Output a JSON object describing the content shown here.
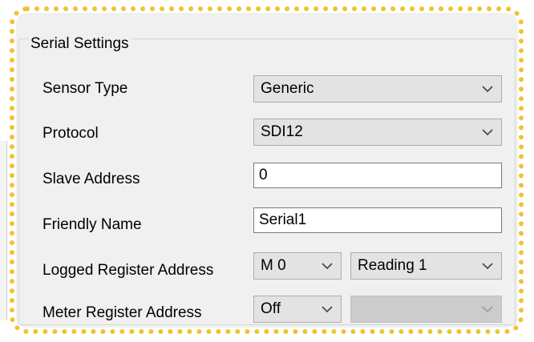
{
  "group": {
    "title": "Serial Settings"
  },
  "rows": {
    "sensor_type": {
      "label": "Sensor Type",
      "value": "Generic"
    },
    "protocol": {
      "label": "Protocol",
      "value": "SDI12"
    },
    "slave_address": {
      "label": "Slave Address",
      "value": "0"
    },
    "friendly_name": {
      "label": "Friendly Name",
      "value": "Serial1"
    },
    "logged_register": {
      "label": "Logged Register Address",
      "value1": "M 0",
      "value2": "Reading 1"
    },
    "meter_register": {
      "label": "Meter Register Address",
      "value1": "Off",
      "value2": ""
    }
  },
  "icons": {
    "dropdown": "chevron-down-icon"
  },
  "colors": {
    "highlight_border": "#f1c232",
    "panel_bg": "#f0f0f0"
  }
}
